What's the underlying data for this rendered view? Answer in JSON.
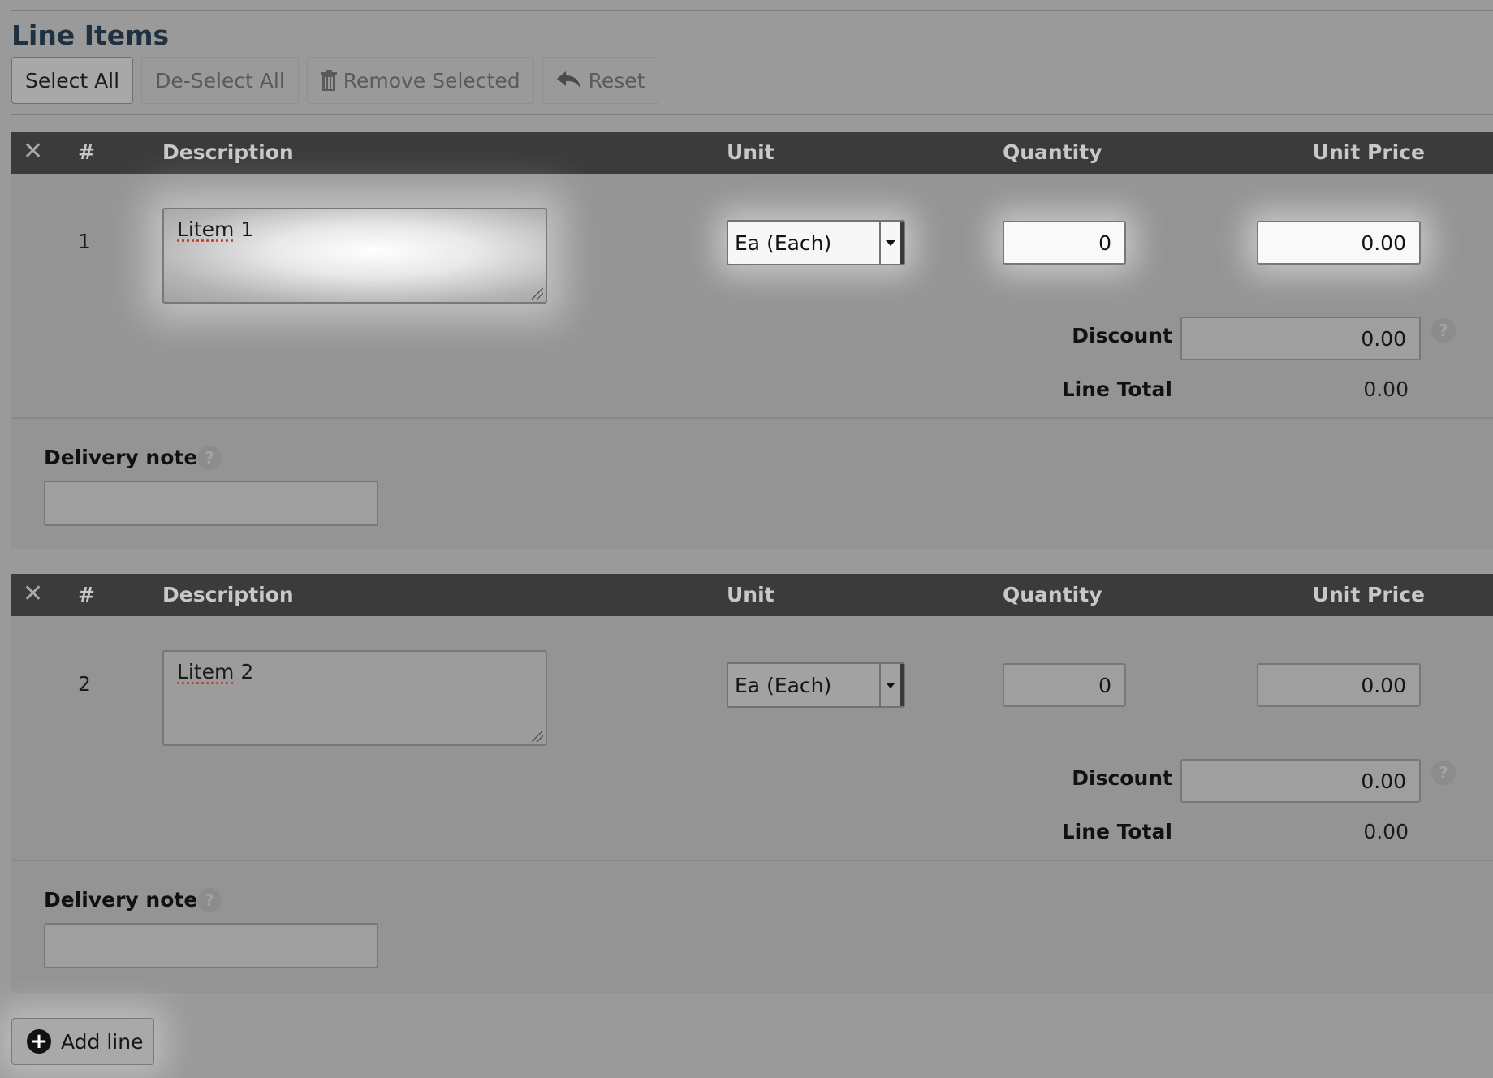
{
  "section": {
    "title": "Line Items"
  },
  "toolbar": {
    "select_all": "Select All",
    "deselect_all": "De-Select All",
    "remove_selected": "Remove Selected",
    "reset": "Reset"
  },
  "table_headers": {
    "remove": "✕",
    "number": "#",
    "description": "Description",
    "unit": "Unit",
    "quantity": "Quantity",
    "unit_price": "Unit Price"
  },
  "labels": {
    "discount": "Discount",
    "line_total": "Line Total",
    "delivery_note": "Delivery note",
    "help": "?"
  },
  "line_items": [
    {
      "number": "1",
      "description_word": "Litem",
      "description_rest": " 1",
      "unit": "Ea (Each)",
      "quantity": "0",
      "unit_price": "0.00",
      "discount": "0.00",
      "line_total": "0.00",
      "delivery_note": ""
    },
    {
      "number": "2",
      "description_word": "Litem",
      "description_rest": " 2",
      "unit": "Ea (Each)",
      "quantity": "0",
      "unit_price": "0.00",
      "discount": "0.00",
      "line_total": "0.00",
      "delivery_note": ""
    }
  ],
  "add_line": {
    "label": "Add line",
    "icon": "plus-circle-icon"
  },
  "icons": {
    "remove_selected": "trash-icon",
    "reset": "undo-arrow-icon",
    "remove_column": "close-icon",
    "unit_dropdown": "chevron-down-icon",
    "help": "help-icon"
  }
}
